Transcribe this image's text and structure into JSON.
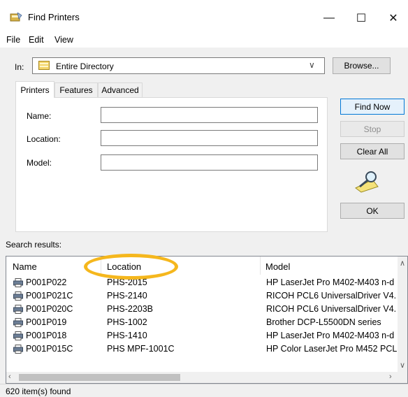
{
  "window": {
    "title": "Find Printers",
    "minimize": "—",
    "maximize": "☐",
    "close": "✕"
  },
  "menu": [
    "File",
    "Edit",
    "View"
  ],
  "scope": {
    "label": "In:",
    "value": "Entire Directory",
    "arrow": "∨",
    "browse": "Browse..."
  },
  "tabs": [
    "Printers",
    "Features",
    "Advanced"
  ],
  "fields": {
    "name": "Name:",
    "location": "Location:",
    "model": "Model:"
  },
  "buttons": {
    "find_now": "Find Now",
    "stop": "Stop",
    "clear_all": "Clear All",
    "ok": "OK"
  },
  "results": {
    "label": "Search results:",
    "columns": [
      "Name",
      "Location",
      "Model"
    ],
    "rows": [
      {
        "name": "P001P022",
        "location": "PHS-2015",
        "model": "HP LaserJet Pro M402-M403 n-d"
      },
      {
        "name": "P001P021C",
        "location": "PHS-2140",
        "model": "RICOH PCL6 UniversalDriver V4."
      },
      {
        "name": "P001P020C",
        "location": "PHS-2203B",
        "model": "RICOH PCL6 UniversalDriver V4."
      },
      {
        "name": "P001P019",
        "location": "PHS-1002",
        "model": "Brother DCP-L5500DN series"
      },
      {
        "name": "P001P018",
        "location": "PHS-1410",
        "model": "HP LaserJet Pro M402-M403 n-d"
      },
      {
        "name": "P001P015C",
        "location": "PHS MPF-1001C",
        "model": "HP Color LaserJet Pro M452 PCL"
      }
    ]
  },
  "status": "620 item(s) found",
  "colors": {
    "highlight": "#f5b71d",
    "accent": "#0078d7"
  }
}
